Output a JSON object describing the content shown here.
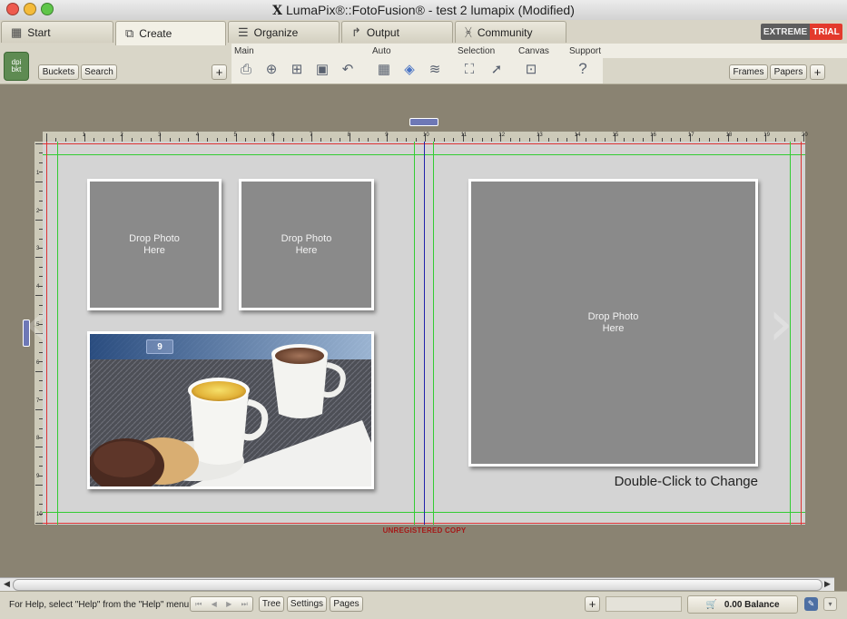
{
  "window": {
    "title": "LumaPix®::FotoFusion® - test 2 lumapix (Modified)",
    "app_glyph": "X",
    "traffic_colors": [
      "#ee5a4f",
      "#f4bb3b",
      "#5fc64a"
    ]
  },
  "tabs": [
    {
      "label": "Start",
      "icon": "grid-icon"
    },
    {
      "label": "Create",
      "icon": "create-icon",
      "active": true
    },
    {
      "label": "Organize",
      "icon": "list-icon"
    },
    {
      "label": "Output",
      "icon": "output-arrow-icon"
    },
    {
      "label": "Community",
      "icon": "community-icon"
    }
  ],
  "badges": {
    "extreme": "EXTREME",
    "trial": "TRIAL"
  },
  "left_panel": {
    "logo_text": "dpi\nbkt",
    "buttons": {
      "buckets": "Buckets",
      "search": "Search",
      "add": "+"
    }
  },
  "toolbar": {
    "groups": {
      "main": "Main",
      "auto": "Auto",
      "selection": "Selection",
      "canvas": "Canvas",
      "support": "Support"
    }
  },
  "right_panel": {
    "buttons": {
      "frames": "Frames",
      "papers": "Papers",
      "add": "+"
    }
  },
  "canvas": {
    "placeholder_text": "Drop Photo\nHere",
    "page_badge": "9",
    "hint": "Double-Click to Change",
    "watermark": "UNREGISTERED COPY",
    "ruler_top_labels": [
      "1",
      "2",
      "3",
      "4",
      "5",
      "6",
      "7",
      "8",
      "9",
      "10",
      "11",
      "12",
      "13",
      "14",
      "15",
      "16",
      "17",
      "18",
      "19",
      "20"
    ],
    "ruler_left_labels": [
      "1",
      "2",
      "3",
      "4",
      "5",
      "6",
      "7",
      "8",
      "9",
      "10"
    ]
  },
  "statusbar": {
    "help_text": "For Help, select \"Help\" from the \"Help\" menu",
    "tree": "Tree",
    "settings": "Settings",
    "pages": "Pages",
    "add": "+",
    "balance": "0.00 Balance"
  }
}
